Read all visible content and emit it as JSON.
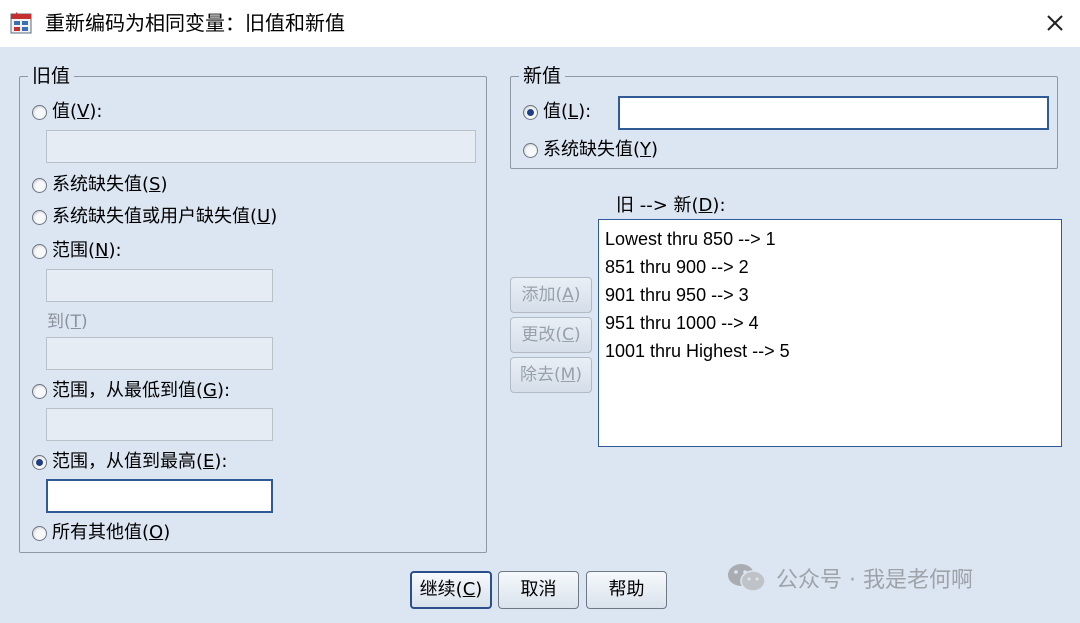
{
  "window": {
    "title": "重新编码为相同变量：旧值和新值",
    "app_icon": "spss-recode-icon",
    "close_icon": "close-icon"
  },
  "old_value": {
    "legend": "旧值",
    "value_radio": {
      "text": "值(",
      "key": "V",
      "suffix": "):",
      "selected": false
    },
    "value_input": {
      "value": ""
    },
    "system_missing_radio": {
      "text": "系统缺失值(",
      "key": "S",
      "suffix": ")",
      "selected": false
    },
    "system_or_user_missing_radio": {
      "text": "系统缺失值或用户缺失值(",
      "key": "U",
      "suffix": ")",
      "selected": false
    },
    "range_radio": {
      "text": "范围(",
      "key": "N",
      "suffix": "):",
      "selected": false
    },
    "range_from_input": {
      "value": ""
    },
    "range_to_label": {
      "text": "到(",
      "key": "T",
      "suffix": ")"
    },
    "range_to_input": {
      "value": ""
    },
    "range_lowest_radio": {
      "text": "范围，从最低到值(",
      "key": "G",
      "suffix": "):",
      "selected": false
    },
    "range_lowest_input": {
      "value": ""
    },
    "range_highest_radio": {
      "text": "范围，从值到最高(",
      "key": "E",
      "suffix": "):",
      "selected": true
    },
    "range_highest_input": {
      "value": ""
    },
    "all_other_radio": {
      "text": "所有其他值(",
      "key": "O",
      "suffix": ")",
      "selected": false
    }
  },
  "new_value": {
    "legend": "新值",
    "value_radio": {
      "text": "值(",
      "key": "L",
      "suffix": "):",
      "selected": true
    },
    "value_input": {
      "value": ""
    },
    "system_missing_radio": {
      "text": "系统缺失值(",
      "key": "Y",
      "suffix": ")",
      "selected": false
    }
  },
  "mapping": {
    "label": {
      "text": "旧 --> 新(",
      "key": "D",
      "suffix": "):"
    },
    "items": [
      "Lowest thru 850 --> 1",
      "851 thru 900 --> 2",
      "901 thru 950 --> 3",
      "951 thru 1000 --> 4",
      "1001 thru Highest --> 5"
    ]
  },
  "side_buttons": {
    "add": {
      "text": "添加(",
      "key": "A",
      "suffix": ")"
    },
    "change": {
      "text": "更改(",
      "key": "C",
      "suffix": ")"
    },
    "remove": {
      "text": "除去(",
      "key": "M",
      "suffix": ")"
    }
  },
  "bottom_buttons": {
    "continue": {
      "text": "继续(",
      "key": "C",
      "suffix": ")"
    },
    "cancel": "取消",
    "help": "帮助"
  },
  "watermark": {
    "text": "公众号 · 我是老何啊",
    "icon": "wechat-icon"
  },
  "colors": {
    "dialog_background": "#dce6f2",
    "titlebar": "#ffffff",
    "active_border": "#2f5a96",
    "disabled_text": "#98a1ab"
  }
}
